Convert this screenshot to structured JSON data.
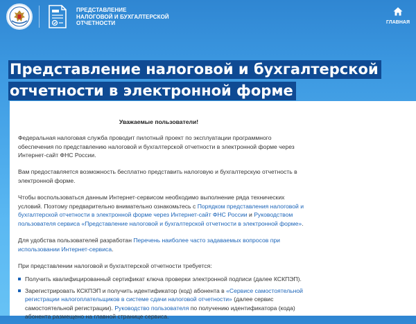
{
  "header": {
    "service_title_lines": [
      "ПРЕДСТАВЛЕНИЕ",
      "НАЛОГОВОЙ И БУХГАЛТЕРСКОЙ",
      "ОТЧЕТНОСТИ"
    ],
    "home_label": "ГЛАВНАЯ",
    "emblem_icon": "fns-emblem-icon",
    "service_icon": "report-document-icon",
    "home_icon": "home-icon"
  },
  "page_title": "Представление налоговой и бухгалтерской отчетности в электронной форме",
  "content": {
    "greeting": "Уважаемые пользователи!",
    "p1": "Федеральная налоговая служба проводит пилотный проект по эксплуатации программного обеспечения по представлению налоговой и бухгалтерской отчетности в электронной форме через Интернет-сайт ФНС России.",
    "p2": "Вам предоставляется возможность бесплатно представить налоговую и бухгалтерскую отчетность в электронной форме.",
    "p3": {
      "text_before": "Чтобы воспользоваться данным Интернет-сервисом необходимо выполнение ряда технических условий. Поэтому предварительно внимательно ознакомьтесь с ",
      "link1": "Порядком представления налоговой и бухгалтерской отчетности в электронной форме через Интернет-сайт ФНС России",
      "text_middle": " и ",
      "link2": "Руководством пользователя сервиса «Представление налоговой и бухгалтерской отчетности в электронной форме»",
      "text_after": "."
    },
    "p4": {
      "text_before": "Для удобства пользователей разработан ",
      "link": "Перечень наиболее часто задаваемых вопросов при использовании Интернет-сервиса",
      "text_after": "."
    },
    "p5": "При представлении налоговой и бухгалтерской отчетности требуется:",
    "list": {
      "item1": "Получить квалифицированный сертификат ключа проверки электронной подписи (далее КСКПЭП).",
      "item2": {
        "text_before": "Зарегистрировать КСКПЭП и получить идентификатор (код) абонента в ",
        "link1": "«Сервисе самостоятельной регистрации налогоплательщиков в системе сдачи налоговой отчетности»",
        "text_middle": " (далее сервис самостоятельной регистрации). ",
        "link2": "Руководство пользователя",
        "text_after": " по получению идентификатора (кода) абонента размещено на главной странице сервиса."
      }
    }
  },
  "colors": {
    "header_blue": "#2f86d2",
    "title_bar": "#0f4a93",
    "link": "#1b64b8",
    "text": "#333333"
  }
}
